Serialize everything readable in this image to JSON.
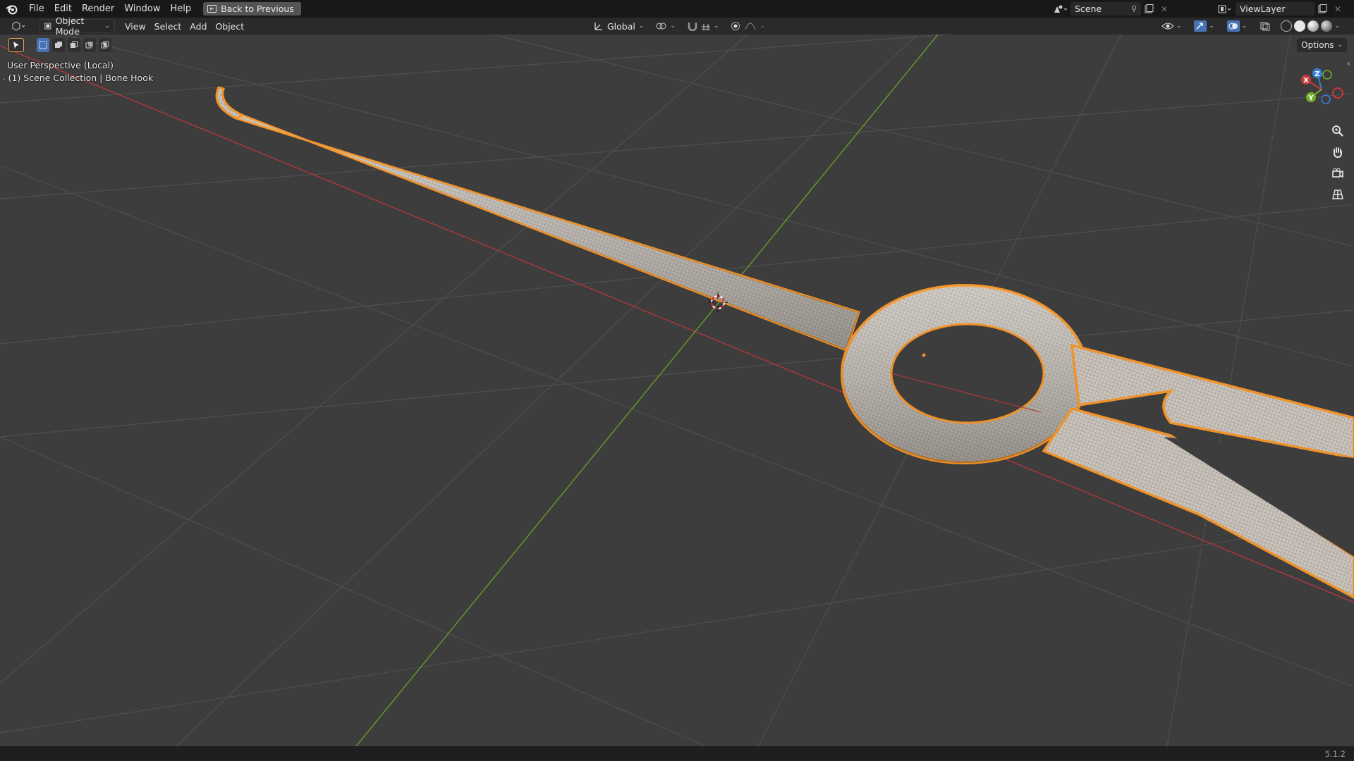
{
  "menu": [
    "File",
    "Edit",
    "Render",
    "Window",
    "Help"
  ],
  "back_button": "Back to Previous",
  "scene": {
    "label": "Scene"
  },
  "view_layer": {
    "label": "ViewLayer"
  },
  "header": {
    "mode": "Object Mode",
    "menus": [
      "View",
      "Select",
      "Add",
      "Object"
    ],
    "orientation": "Global"
  },
  "viewport": {
    "perspective": "User Perspective (Local)",
    "collection": "(1) Scene Collection | Bone Hook",
    "options": "Options"
  },
  "gizmo": {
    "x": "X",
    "y": "Y",
    "z": "Z"
  },
  "status": {
    "version": "5.1.2"
  },
  "colors": {
    "selection": "#f0922a",
    "x_axis": "#c23a3a",
    "y_axis": "#6db82e",
    "accent": "#4772b3"
  }
}
